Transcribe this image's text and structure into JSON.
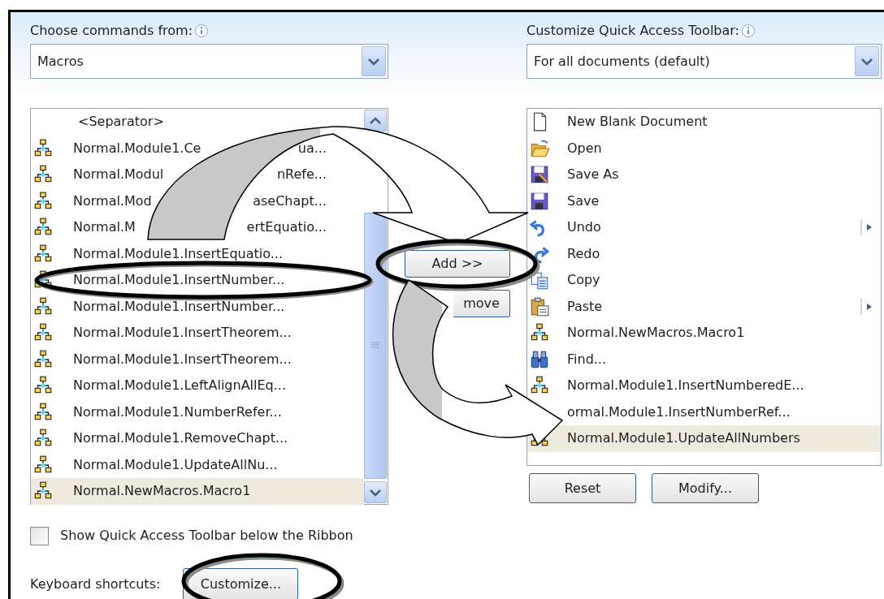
{
  "left": {
    "label": "Choose commands from:",
    "dropdown": {
      "value": "Macros"
    },
    "items": [
      {
        "kind": "separator",
        "parts": [
          "<Separator>"
        ],
        "selected": false
      },
      {
        "kind": "macro",
        "parts": [
          "Normal.Module1.Ce",
          "ua..."
        ],
        "selected": false
      },
      {
        "kind": "macro",
        "parts": [
          "Normal.Modul",
          "nRefe..."
        ],
        "selected": false
      },
      {
        "kind": "macro",
        "parts": [
          "Normal.Mod",
          "aseChapt..."
        ],
        "selected": false
      },
      {
        "kind": "macro",
        "parts": [
          "Normal.M",
          "ertEquatio..."
        ],
        "selected": false
      },
      {
        "kind": "macro",
        "parts": [
          "Normal.Module1.InsertEquatio..."
        ],
        "selected": false
      },
      {
        "kind": "macro",
        "parts": [
          "Normal.Module1.InsertNumber..."
        ],
        "selected": false
      },
      {
        "kind": "macro",
        "parts": [
          "Normal.Module1.InsertNumber..."
        ],
        "selected": false
      },
      {
        "kind": "macro",
        "parts": [
          "Normal.Module1.InsertTheorem..."
        ],
        "selected": false
      },
      {
        "kind": "macro",
        "parts": [
          "Normal.Module1.InsertTheorem..."
        ],
        "selected": false
      },
      {
        "kind": "macro",
        "parts": [
          "Normal.Module1.LeftAlignAllEq..."
        ],
        "selected": false
      },
      {
        "kind": "macro",
        "parts": [
          "Normal.Module1.NumberRefer..."
        ],
        "selected": false
      },
      {
        "kind": "macro",
        "parts": [
          "Normal.Module1.RemoveChapt..."
        ],
        "selected": false
      },
      {
        "kind": "macro",
        "parts": [
          "Normal.Module1.UpdateAllNu..."
        ],
        "selected": false
      },
      {
        "kind": "macro",
        "parts": [
          "Normal.NewMacros.Macro1"
        ],
        "selected": true
      }
    ]
  },
  "middle": {
    "add_button": {
      "label": "Add >>"
    },
    "remove_button": {
      "label": "move"
    }
  },
  "right": {
    "label": "Customize Quick Access Toolbar:",
    "dropdown": {
      "value": "For all documents (default)"
    },
    "items": [
      {
        "kind": "page",
        "label": "New Blank Document",
        "submenu": false,
        "selected": false
      },
      {
        "kind": "folder",
        "label": "Open",
        "submenu": false,
        "selected": false
      },
      {
        "kind": "save-as",
        "label": "Save As",
        "submenu": false,
        "selected": false
      },
      {
        "kind": "save",
        "label": "Save",
        "submenu": false,
        "selected": false
      },
      {
        "kind": "undo",
        "label": "Undo",
        "submenu": true,
        "selected": false
      },
      {
        "kind": "redo",
        "label": "Redo",
        "submenu": false,
        "selected": false
      },
      {
        "kind": "copy",
        "label": "Copy",
        "submenu": false,
        "selected": false
      },
      {
        "kind": "paste",
        "label": "Paste",
        "submenu": true,
        "selected": false
      },
      {
        "kind": "macro",
        "label": "Normal.NewMacros.Macro1",
        "submenu": false,
        "selected": false
      },
      {
        "kind": "find",
        "label": "Find...",
        "submenu": false,
        "selected": false
      },
      {
        "kind": "macro",
        "label": "Normal.Module1.InsertNumberedE...",
        "submenu": false,
        "selected": false
      },
      {
        "label": "ormal.Module1.InsertNumberRef...",
        "submenu": false,
        "selected": false
      },
      {
        "kind": "macro",
        "label": "Normal.Module1.UpdateAllNumbers",
        "submenu": false,
        "selected": true
      }
    ],
    "reset_button": {
      "label": "Reset"
    },
    "modify_button": {
      "label": "Modify..."
    }
  },
  "show_below_ribbon": {
    "label": "Show Quick Access Toolbar below the Ribbon",
    "checked": false
  },
  "keyboard_shortcuts": {
    "label": "Keyboard shortcuts:",
    "button": {
      "label": "Customize..."
    }
  }
}
